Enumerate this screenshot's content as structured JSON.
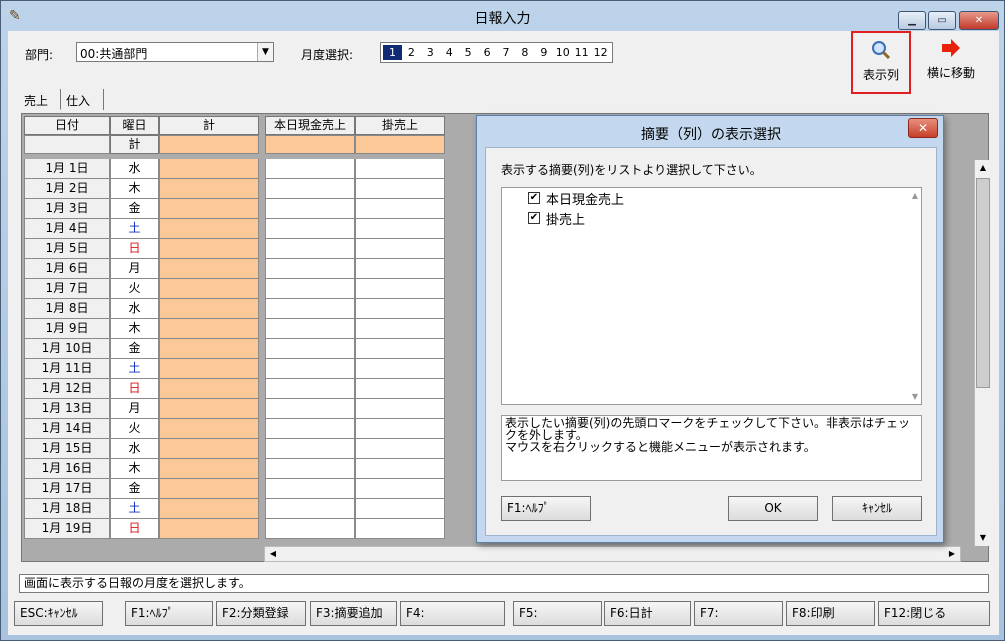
{
  "window": {
    "title": "日報入力",
    "min_label": "▁",
    "max_label": "▭",
    "close_label": "✕"
  },
  "header": {
    "dept_label": "部門:",
    "dept_value": "00:共通部門",
    "month_label": "月度選択:",
    "months": [
      "1",
      "2",
      "3",
      "4",
      "5",
      "6",
      "7",
      "8",
      "9",
      "10",
      "11",
      "12"
    ],
    "selected_month": "1"
  },
  "toolbar": {
    "view_columns": "表示列",
    "move_right": "横に移動"
  },
  "tabs": {
    "sales": "売上",
    "purchase": "仕入"
  },
  "grid": {
    "headers": {
      "date": "日付",
      "day": "曜日",
      "total": "計",
      "cash_sales": "本日現金売上",
      "credit_sales": "掛売上"
    },
    "subheader_day": "計",
    "rows": [
      {
        "date": "1月 1日",
        "day": "水",
        "type": "weekday"
      },
      {
        "date": "1月 2日",
        "day": "木",
        "type": "weekday"
      },
      {
        "date": "1月 3日",
        "day": "金",
        "type": "weekday"
      },
      {
        "date": "1月 4日",
        "day": "土",
        "type": "sat"
      },
      {
        "date": "1月 5日",
        "day": "日",
        "type": "sun"
      },
      {
        "date": "1月 6日",
        "day": "月",
        "type": "weekday"
      },
      {
        "date": "1月 7日",
        "day": "火",
        "type": "weekday"
      },
      {
        "date": "1月 8日",
        "day": "水",
        "type": "weekday"
      },
      {
        "date": "1月 9日",
        "day": "木",
        "type": "weekday"
      },
      {
        "date": "1月 10日",
        "day": "金",
        "type": "weekday"
      },
      {
        "date": "1月 11日",
        "day": "土",
        "type": "sat"
      },
      {
        "date": "1月 12日",
        "day": "日",
        "type": "sun"
      },
      {
        "date": "1月 13日",
        "day": "月",
        "type": "weekday"
      },
      {
        "date": "1月 14日",
        "day": "火",
        "type": "weekday"
      },
      {
        "date": "1月 15日",
        "day": "水",
        "type": "weekday"
      },
      {
        "date": "1月 16日",
        "day": "木",
        "type": "weekday"
      },
      {
        "date": "1月 17日",
        "day": "金",
        "type": "weekday"
      },
      {
        "date": "1月 18日",
        "day": "土",
        "type": "sat"
      },
      {
        "date": "1月 19日",
        "day": "日",
        "type": "sun"
      }
    ]
  },
  "status": "画面に表示する日報の月度を選択します。",
  "fkeys": [
    {
      "label": "ESC:ｷｬﾝｾﾙ"
    },
    {
      "label": "F1:ﾍﾙﾌﾟ"
    },
    {
      "label": "F2:分類登録"
    },
    {
      "label": "F3:摘要追加"
    },
    {
      "label": "F4:"
    },
    {
      "label": "F5:"
    },
    {
      "label": "F6:日計"
    },
    {
      "label": "F7:"
    },
    {
      "label": "F8:印刷"
    },
    {
      "label": "F12:閉じる"
    }
  ],
  "dialog": {
    "title": "摘要（列）の表示選択",
    "close_label": "✕",
    "instruction": "表示する摘要(列)をリストより選択して下さい。",
    "items": [
      {
        "label": "本日現金売上",
        "checked": true
      },
      {
        "label": "掛売上",
        "checked": true
      }
    ],
    "help_line1": "表示したい摘要(列)の先頭ロマークをチェックして下さい。非表示はチェックを外します。",
    "help_line2": "マウスを右クリックすると機能メニューが表示されます。",
    "help_button": "F1:ﾍﾙﾌﾟ",
    "ok_button": "OK",
    "cancel_button": "ｷｬﾝｾﾙ"
  }
}
